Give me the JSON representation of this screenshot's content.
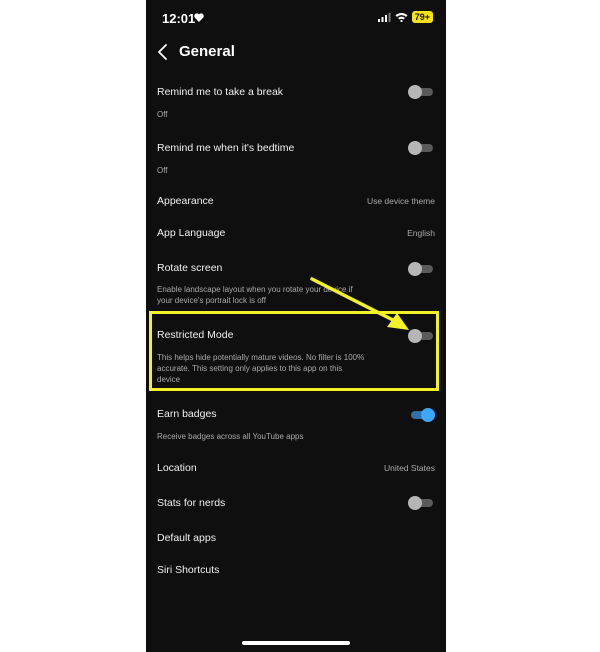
{
  "status_bar": {
    "time": "12:01",
    "battery": "79+"
  },
  "header": {
    "title": "General"
  },
  "settings": {
    "break_reminder": {
      "label": "Remind me to take a break",
      "sub": "Off"
    },
    "bedtime_reminder": {
      "label": "Remind me when it's bedtime",
      "sub": "Off"
    },
    "appearance": {
      "label": "Appearance",
      "value": "Use device theme"
    },
    "app_language": {
      "label": "App Language",
      "value": "English"
    },
    "rotate_screen": {
      "label": "Rotate screen",
      "sub_line1": "Enable landscape layout when you rotate your device if",
      "sub_line2": "your device's portrait lock is off"
    },
    "restricted_mode": {
      "label": "Restricted Mode",
      "sub_line1": "This helps hide potentially mature videos. No filter is 100%",
      "sub_line2": "accurate. This setting only applies to this app on this",
      "sub_line3": "device"
    },
    "earn_badges": {
      "label": "Earn badges",
      "sub": "Receive badges across all YouTube apps"
    },
    "location": {
      "label": "Location",
      "value": "United States"
    },
    "stats_for_nerds": {
      "label": "Stats for nerds"
    },
    "default_apps": {
      "label": "Default apps"
    },
    "siri_shortcuts": {
      "label": "Siri Shortcuts"
    }
  },
  "toggles": {
    "break_reminder": "off",
    "bedtime_reminder": "off",
    "rotate_screen": "off",
    "restricted_mode": "off",
    "earn_badges": "on",
    "stats_for_nerds": "off"
  },
  "colors": {
    "background": "#0f0f0f",
    "toggle_on": "#3ea6ff",
    "highlight": "#f4f127"
  },
  "icons": [
    "heart-icon",
    "signal-icon",
    "wifi-icon",
    "battery-icon",
    "back-chevron-icon",
    "arrow-annotation-icon"
  ]
}
